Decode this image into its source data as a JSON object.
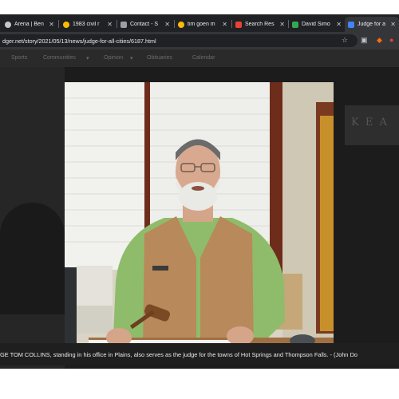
{
  "browser": {
    "tabs": [
      {
        "label": "Arena | Ben",
        "icon": "wordpress-icon",
        "color": "#c4c7c5"
      },
      {
        "label": "1983 civil r",
        "icon": "google-icon",
        "color": "#fbbc05"
      },
      {
        "label": "Contact - S",
        "icon": "balance-scale-icon",
        "color": "#c4c7c5"
      },
      {
        "label": "tim goen m",
        "icon": "google-icon",
        "color": "#fbbc05"
      },
      {
        "label": "Search Res",
        "icon": "acrobat-icon",
        "color": "#ea4335"
      },
      {
        "label": "David Simo",
        "icon": "google-sheets-icon",
        "color": "#34a853"
      },
      {
        "label": "Judge for a",
        "icon": "site-icon",
        "color": "#4285f4",
        "active": true
      }
    ],
    "url": "dger.net/story/2021/05/13/news/judge-for-all-cities/6187.html"
  },
  "site_nav": {
    "items": [
      "Sports",
      "Communities",
      "Opinion",
      "Obituaries",
      "Calendar"
    ]
  },
  "ad_text": "K E A",
  "photo": {
    "caption": "GE TOM COLLINS, standing in his office in Plains, also serves as the judge for the towns of Hot Springs and Thompson Falls. - (John Do"
  }
}
